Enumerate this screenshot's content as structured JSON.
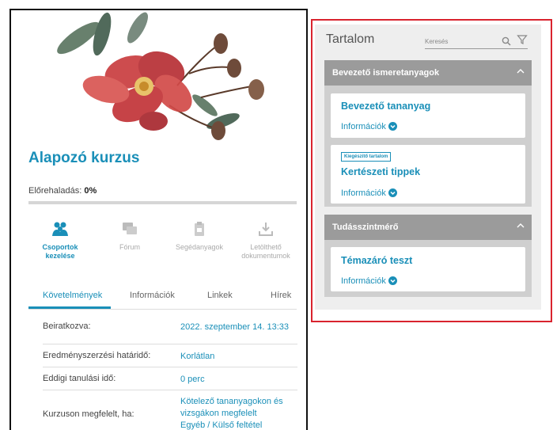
{
  "course": {
    "title": "Alapozó kurzus",
    "progress_label": "Előrehaladás:",
    "progress_value": "0%",
    "progress_fraction": 0
  },
  "tools": [
    {
      "label_line1": "Csoportok",
      "label_line2": "kezelése",
      "icon": "groups-icon",
      "active": true
    },
    {
      "label_line1": "Fórum",
      "label_line2": "",
      "icon": "forum-icon",
      "active": false
    },
    {
      "label_line1": "Segédanyagok",
      "label_line2": "",
      "icon": "materials-icon",
      "active": false
    },
    {
      "label_line1": "Letölthető",
      "label_line2": "dokumentumok",
      "icon": "download-icon",
      "active": false
    }
  ],
  "tabs": [
    "Követelmények",
    "Információk",
    "Linkek",
    "Hírek"
  ],
  "requirements": [
    {
      "key": "Beiratkozva:",
      "value": "2022. szeptember 14. 13:33"
    },
    {
      "key": "Eredményszerzési határidő:",
      "value": "Korlátlan"
    },
    {
      "key": "Eddigi tanulási idő:",
      "value": "0 perc"
    },
    {
      "key": "Kurzuson megfelelt, ha:",
      "value_line1": "Kötelező tananyagokon és",
      "value_line2": "vizsgákon megfelelt",
      "value_line3": "Egyéb / Külső feltétel teljesítve"
    }
  ],
  "content_panel": {
    "title": "Tartalom",
    "search_placeholder": "Keresés",
    "sections": [
      {
        "title": "Bevezető ismeretanyagok",
        "items": [
          {
            "name": "Bevezető tananyag",
            "info": "Információk"
          },
          {
            "badge": "Kiegészítő tartalom",
            "name": "Kertészeti tippek",
            "info": "Információk"
          }
        ]
      },
      {
        "title": "Tudásszintmérő",
        "items": [
          {
            "name": "Témazáró teszt",
            "info": "Információk"
          }
        ]
      }
    ]
  },
  "colors": {
    "accent": "#1a8fb8",
    "section_header": "#9b9b9b",
    "highlight_frame": "#d9232e"
  }
}
